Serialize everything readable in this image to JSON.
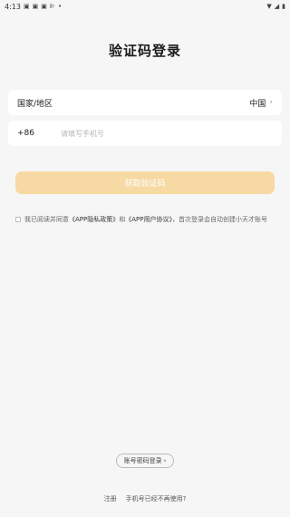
{
  "status_bar": {
    "time": "4:13",
    "left_icons": [
      "notification-icon",
      "notification-icon",
      "notification-icon",
      "nfc-icon",
      "dot-icon"
    ],
    "right_icons": [
      "wifi-icon",
      "signal-icon",
      "battery-icon"
    ]
  },
  "title": "验证码登录",
  "region": {
    "label": "国家/地区",
    "value": "中国"
  },
  "phone": {
    "country_code": "+86",
    "placeholder": "请填写手机号",
    "value": ""
  },
  "get_code_button": "获取验证码",
  "agreement": {
    "checked": false,
    "prefix": "我已阅读并同意",
    "privacy_link": "《APP隐私政策》",
    "and": "和",
    "user_agreement_link": "《APP用户协议》",
    "suffix": "，首次登录会自动创建小天才账号"
  },
  "password_login": "账号密码登录",
  "bottom": {
    "register": "注册",
    "phone_unavailable": "手机号已经不再使用?"
  },
  "colors": {
    "accent": "#f7d9a3",
    "background": "#f6f6f6"
  }
}
